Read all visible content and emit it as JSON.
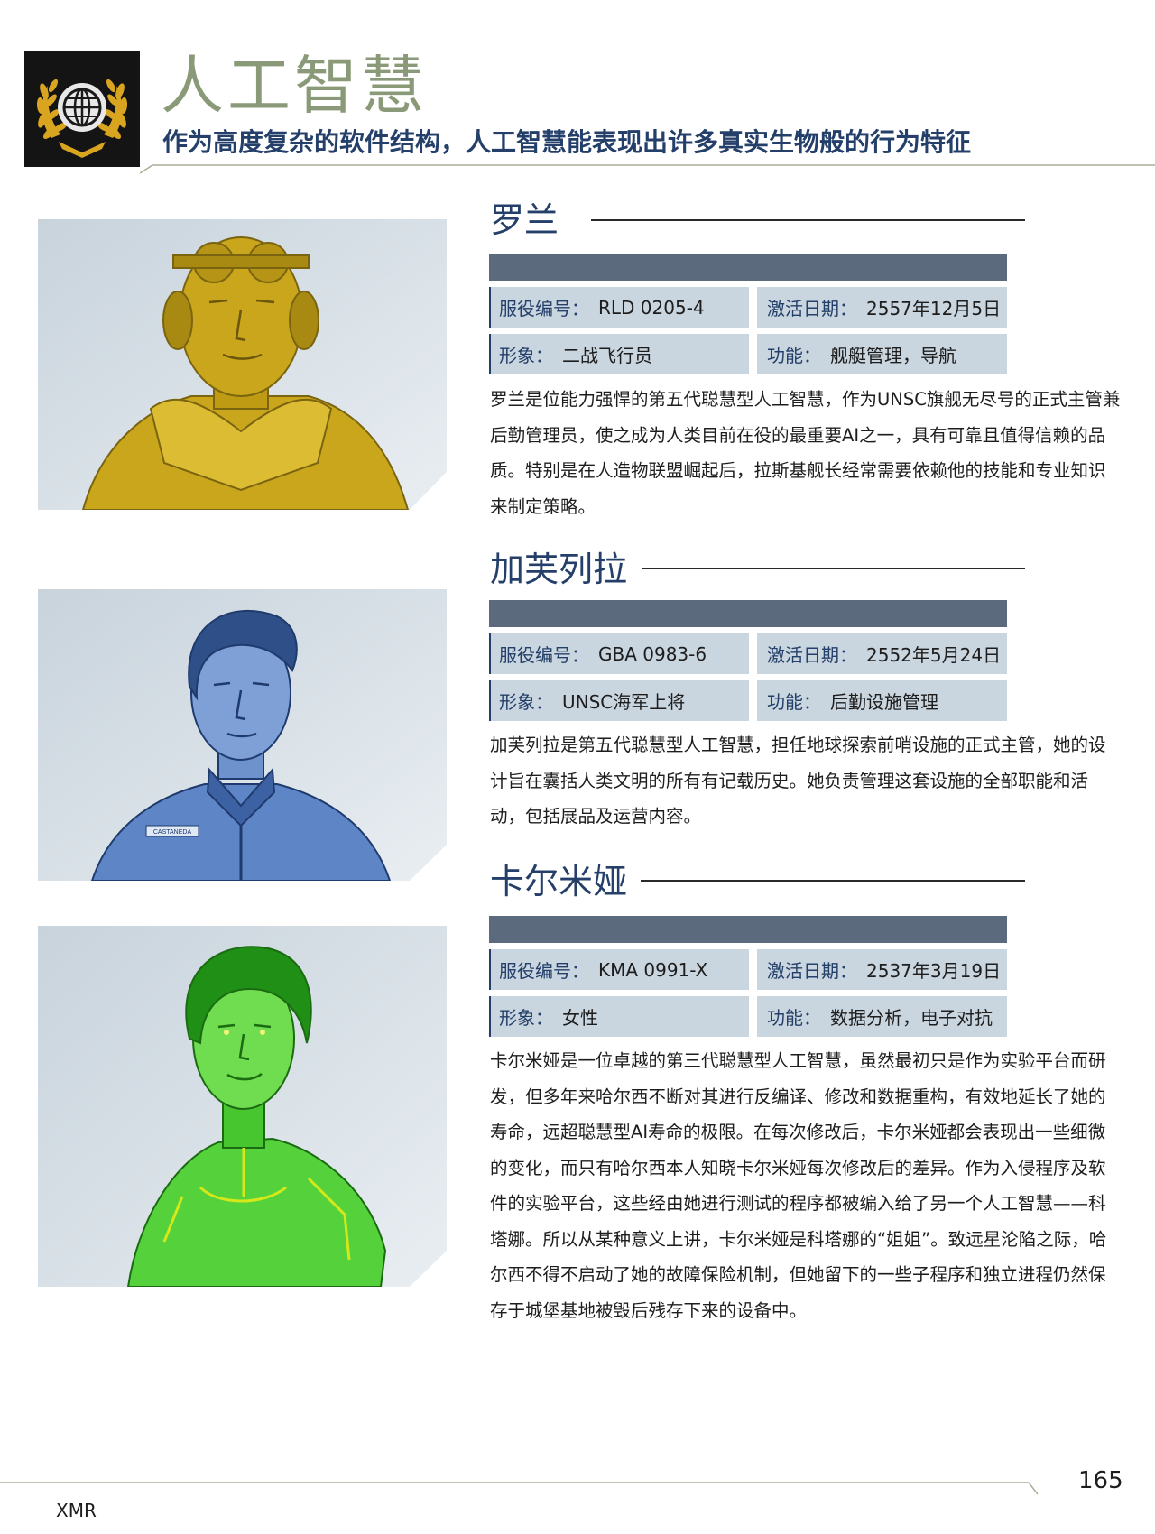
{
  "header": {
    "title": "人工智慧",
    "subtitle": "作为高度复杂的软件结构，人工智慧能表现出许多真实生物般的行为特征",
    "emblem_icon": "globe-laurel-icon"
  },
  "labels": {
    "service_id": "服役编号：",
    "activation_date": "激活日期：",
    "appearance": "形象：",
    "function": "功能："
  },
  "ais": [
    {
      "name": "罗兰",
      "service_id": "RLD 0205-4",
      "activation_date": "2557年12月5日",
      "appearance": "二战飞行员",
      "function": "舰艇管理，导航",
      "portrait_color": "#c9a61b",
      "description": "罗兰是位能力强悍的第五代聪慧型人工智慧，作为UNSC旗舰无尽号的正式主管兼后勤管理员，使之成为人类目前在役的最重要AI之一，具有可靠且值得信赖的品质。特别是在人造物联盟崛起后，拉斯基舰长经常需要依赖他的技能和专业知识来制定策略。"
    },
    {
      "name": "加芙列拉",
      "service_id": "GBA 0983-6",
      "activation_date": "2552年5月24日",
      "appearance": "UNSC海军上将",
      "function": "后勤设施管理",
      "portrait_color": "#4b74b8",
      "name_tag": "CASTANEDA",
      "description": "加芙列拉是第五代聪慧型人工智慧，担任地球探索前哨设施的正式主管，她的设计旨在囊括人类文明的所有有记载历史。她负责管理这套设施的全部职能和活动，包括展品及运营内容。"
    },
    {
      "name": "卡尔米娅",
      "service_id": "KMA 0991-X",
      "activation_date": "2537年3月19日",
      "appearance": "女性",
      "function": "数据分析，电子对抗",
      "portrait_color": "#3ec22a",
      "description": "卡尔米娅是一位卓越的第三代聪慧型人工智慧，虽然最初只是作为实验平台而研发，但多年来哈尔西不断对其进行反编译、修改和数据重构，有效地延长了她的寿命，远超聪慧型AI寿命的极限。在每次修改后，卡尔米娅都会表现出一些细微的变化，而只有哈尔西本人知晓卡尔米娅每次修改后的差异。作为入侵程序及软件的实验平台，这些经由她进行测试的程序都被编入给了另一个人工智慧——科塔娜。所以从某种意义上讲，卡尔米娅是科塔娜的“姐姐”。致远星沦陷之际，哈尔西不得不启动了她的故障保险机制，但她留下的一些子程序和独立进程仍然保存于城堡基地被毁后残存下来的设备中。"
    }
  ],
  "footer": {
    "page_number": "165",
    "code": "XMR"
  }
}
